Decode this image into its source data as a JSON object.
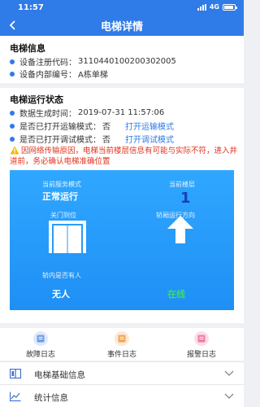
{
  "status_bar": {
    "time": "11:57",
    "network": "4G"
  },
  "nav": {
    "title": "电梯详情"
  },
  "info": {
    "title": "电梯信息",
    "rows": [
      {
        "label": "设备注册代码：",
        "value": "3110440100200302005"
      },
      {
        "label": "设备内部编号：",
        "value": "A栋单梯"
      }
    ]
  },
  "status": {
    "title": "电梯运行状态",
    "generated": {
      "label": "数据生成时间：",
      "value": "2019-07-31 11:57:06"
    },
    "transport": {
      "label": "是否已打开运输模式：",
      "value": "否",
      "link": "打开运输模式"
    },
    "debug": {
      "label": "是否已打开调试模式：",
      "value": "否",
      "link": "打开调试模式"
    },
    "warning": "因网络传输原因，电梯当前楼层信息有可能与实际不符，进入井道前，务必确认电梯准确位置"
  },
  "panel": {
    "service_mode_label": "当前服务模式",
    "service_mode_value": "正常运行",
    "floor_label": "当前楼层",
    "floor_value": "1",
    "door_label": "关门到位",
    "direction_label": "轿厢运行方向",
    "occupancy_label": "轿内是否有人",
    "occupancy_value": "无人",
    "online_value": "在线"
  },
  "shortcuts": [
    {
      "label": "故障日志",
      "icon": "fault-log-icon",
      "color": "#6f9fe6"
    },
    {
      "label": "事件日志",
      "icon": "event-log-icon",
      "color": "#f2a65a"
    },
    {
      "label": "报警日志",
      "icon": "alarm-log-icon",
      "color": "#ee7fa5"
    }
  ],
  "list": [
    {
      "label": "电梯基础信息",
      "icon": "elevator-info-icon"
    },
    {
      "label": "统计信息",
      "icon": "statistics-icon"
    }
  ],
  "colors": {
    "primary": "#2f7be8",
    "warning": "#e0321e",
    "online": "#3ddc6a"
  }
}
